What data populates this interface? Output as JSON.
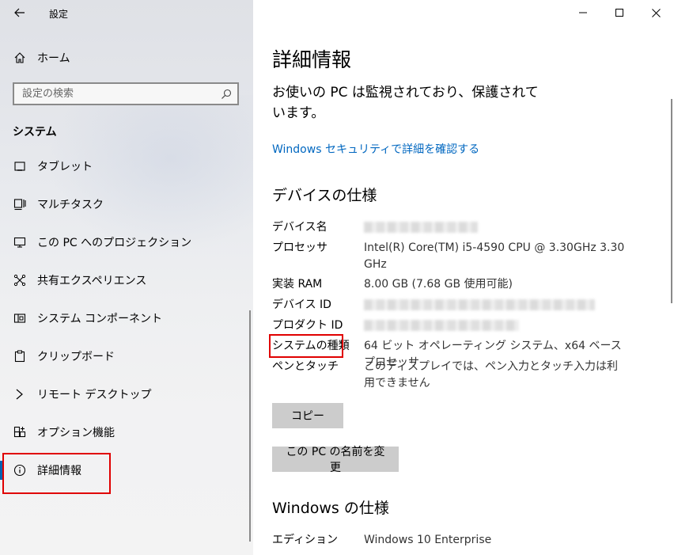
{
  "app": {
    "title": "設定"
  },
  "sidebar": {
    "home_label": "ホーム",
    "search_placeholder": "設定の検索",
    "section_title": "システム",
    "items": [
      {
        "label": "タブレット",
        "icon": "tablet-icon"
      },
      {
        "label": "マルチタスク",
        "icon": "multitask-icon"
      },
      {
        "label": "この PC へのプロジェクション",
        "icon": "projection-icon"
      },
      {
        "label": "共有エクスペリエンス",
        "icon": "shared-experience-icon"
      },
      {
        "label": "システム コンポーネント",
        "icon": "system-components-icon"
      },
      {
        "label": "クリップボード",
        "icon": "clipboard-icon"
      },
      {
        "label": "リモート デスクトップ",
        "icon": "remote-desktop-icon"
      },
      {
        "label": "オプション機能",
        "icon": "optional-features-icon"
      },
      {
        "label": "詳細情報",
        "icon": "info-icon",
        "active": true
      }
    ]
  },
  "main": {
    "title": "詳細情報",
    "protect_text": "お使いの PC は監視されており、保護されています。",
    "security_link": "Windows セキュリティで詳細を確認する",
    "device_spec": {
      "heading": "デバイスの仕様",
      "rows": [
        {
          "label": "デバイス名",
          "value": "",
          "redacted": true
        },
        {
          "label": "プロセッサ",
          "value": "Intel(R) Core(TM) i5-4590 CPU @ 3.30GHz   3.30 GHz"
        },
        {
          "label": "実装 RAM",
          "value": "8.00 GB (7.68 GB 使用可能)"
        },
        {
          "label": "デバイス ID",
          "value": "",
          "redacted": true
        },
        {
          "label": "プロダクト ID",
          "value": "",
          "redacted": true
        },
        {
          "label": "システムの種類",
          "value": "64 ビット オペレーティング システム、x64 ベース プロセッサ",
          "highlighted": true
        },
        {
          "label": "ペンとタッチ",
          "value": "このディスプレイでは、ペン入力とタッチ入力は利用できません"
        }
      ]
    },
    "copy_button": "コピー",
    "rename_button": "この PC の名前を変更",
    "windows_spec": {
      "heading": "Windows の仕様",
      "rows": [
        {
          "label": "エディション",
          "value": "Windows 10 Enterprise"
        }
      ]
    }
  },
  "colors": {
    "accent": "#0063b1",
    "link": "#0067c0",
    "highlight": "#e00000",
    "button_bg": "#cccccc"
  }
}
